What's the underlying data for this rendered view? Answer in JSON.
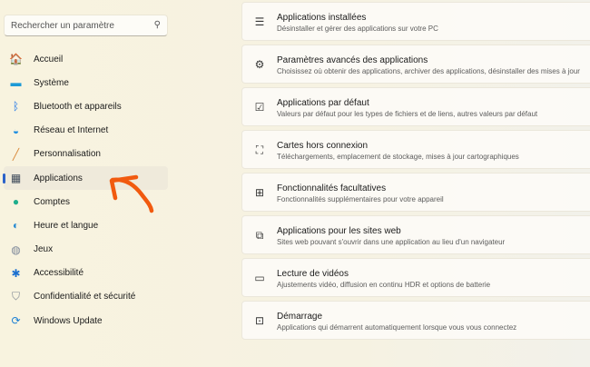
{
  "search": {
    "placeholder": "Rechercher un paramètre",
    "icon": "search-icon"
  },
  "sidebar": {
    "items": [
      {
        "label": "Accueil",
        "icon": "home-icon",
        "glyph": "🏠",
        "color": "#e0792b"
      },
      {
        "label": "Système",
        "icon": "system-icon",
        "glyph": "▬",
        "color": "#1d9ad6"
      },
      {
        "label": "Bluetooth et appareils",
        "icon": "bluetooth-icon",
        "glyph": "ᛒ",
        "color": "#1a73e8"
      },
      {
        "label": "Réseau et Internet",
        "icon": "wifi-icon",
        "glyph": "◒",
        "color": "#1f8ee0"
      },
      {
        "label": "Personnalisation",
        "icon": "brush-icon",
        "glyph": "╱",
        "color": "#d9893a"
      },
      {
        "label": "Applications",
        "icon": "apps-icon",
        "glyph": "▦",
        "color": "#3e4a5a",
        "selected": true
      },
      {
        "label": "Comptes",
        "icon": "account-icon",
        "glyph": "●",
        "color": "#1fae8c"
      },
      {
        "label": "Heure et langue",
        "icon": "globe-clock-icon",
        "glyph": "◐",
        "color": "#2a8bd1"
      },
      {
        "label": "Jeux",
        "icon": "gamepad-icon",
        "glyph": "◍",
        "color": "#7e8899"
      },
      {
        "label": "Accessibilité",
        "icon": "accessibility-icon",
        "glyph": "✱",
        "color": "#1b6fcf"
      },
      {
        "label": "Confidentialité et sécurité",
        "icon": "shield-icon",
        "glyph": "⛉",
        "color": "#7d8591"
      },
      {
        "label": "Windows Update",
        "icon": "update-icon",
        "glyph": "⟳",
        "color": "#1b7fd4"
      }
    ]
  },
  "main": {
    "cards": [
      {
        "title": "Applications installées",
        "subtitle": "Désinstaller et gérer des applications sur votre PC",
        "icon": "list-icon",
        "glyph": "☰"
      },
      {
        "title": "Paramètres avancés des applications",
        "subtitle": "Choisissez où obtenir des applications, archiver des applications, désinstaller des mises à jour",
        "icon": "app-settings-icon",
        "glyph": "⚙"
      },
      {
        "title": "Applications par défaut",
        "subtitle": "Valeurs par défaut pour les types de fichiers et de liens, autres valeurs par défaut",
        "icon": "default-apps-icon",
        "glyph": "☑"
      },
      {
        "title": "Cartes hors connexion",
        "subtitle": "Téléchargements, emplacement de stockage, mises à jour cartographiques",
        "icon": "offline-map-icon",
        "glyph": "⛶"
      },
      {
        "title": "Fonctionnalités facultatives",
        "subtitle": "Fonctionnalités supplémentaires pour votre appareil",
        "icon": "optional-features-icon",
        "glyph": "⊞"
      },
      {
        "title": "Applications pour les sites web",
        "subtitle": "Sites web pouvant s'ouvrir dans une application au lieu d'un navigateur",
        "icon": "web-apps-icon",
        "glyph": "⧉"
      },
      {
        "title": "Lecture de vidéos",
        "subtitle": "Ajustements vidéo, diffusion en continu HDR et options de batterie",
        "icon": "video-icon",
        "glyph": "▭"
      },
      {
        "title": "Démarrage",
        "subtitle": "Applications qui démarrent automatiquement lorsque vous vous connectez",
        "icon": "startup-icon",
        "glyph": "⊡"
      }
    ]
  },
  "annotation": {
    "color": "#f15a0f",
    "icon": "arrow-annotation-icon"
  }
}
